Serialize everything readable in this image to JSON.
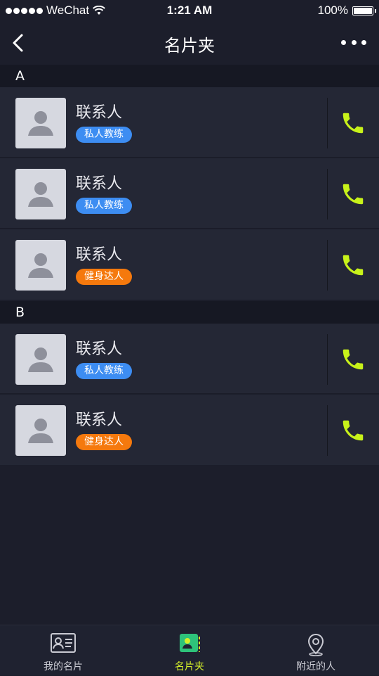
{
  "status_bar": {
    "carrier": "WeChat",
    "time": "1:21 AM",
    "battery": "100%"
  },
  "nav": {
    "title": "名片夹"
  },
  "sections": [
    {
      "letter": "A",
      "contacts": [
        {
          "name": "联系人",
          "tag": "私人教练",
          "tag_color": "blue"
        },
        {
          "name": "联系人",
          "tag": "私人教练",
          "tag_color": "blue"
        },
        {
          "name": "联系人",
          "tag": "健身达人",
          "tag_color": "orange"
        }
      ]
    },
    {
      "letter": "B",
      "contacts": [
        {
          "name": "联系人",
          "tag": "私人教练",
          "tag_color": "blue"
        },
        {
          "name": "联系人",
          "tag": "健身达人",
          "tag_color": "orange"
        }
      ]
    }
  ],
  "tabs": [
    {
      "label": "我的名片",
      "icon": "id-card-icon",
      "active": false
    },
    {
      "label": "名片夹",
      "icon": "card-holder-icon",
      "active": true
    },
    {
      "label": "附近的人",
      "icon": "location-pin-icon",
      "active": false
    }
  ],
  "colors": {
    "background": "#1c1e2b",
    "row": "#242735",
    "section_header": "#161823",
    "tag_blue": "#3d8df2",
    "tag_orange": "#f5790d",
    "call_icon": "#c8f21a",
    "tab_active": "#d4ef2a"
  }
}
